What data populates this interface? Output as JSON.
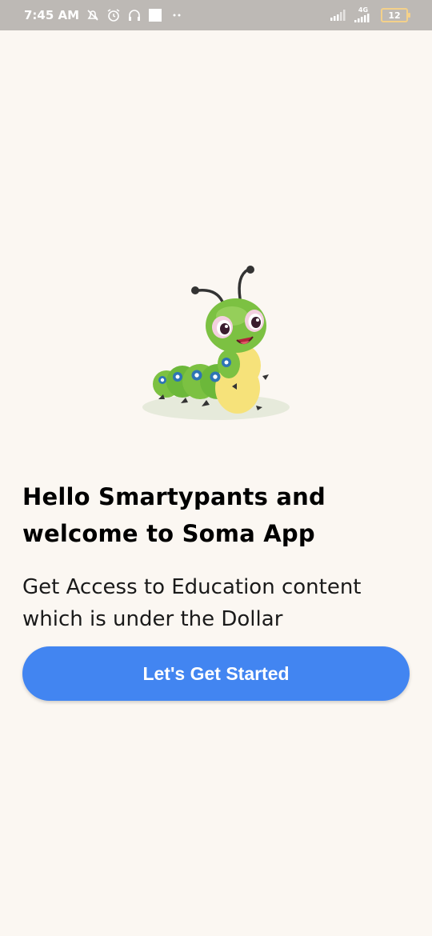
{
  "status_bar": {
    "time": "7:45 AM",
    "icons": [
      "alarm-off-icon",
      "alarm-clock-icon",
      "headset-icon",
      "square-notification-icon",
      "more-dots-icon"
    ],
    "network_label": "4G",
    "battery_level": "12",
    "colors": {
      "background": "#bdb9b5",
      "battery_outline": "#f4d18a"
    }
  },
  "hero": {
    "image": "caterpillar-illustration"
  },
  "welcome": {
    "headline_line1": "Hello Smartypants and",
    "headline_line2": "welcome to Soma App",
    "subtitle_line1": "Get Access to Education content",
    "subtitle_line2": "which is under the Dollar"
  },
  "cta": {
    "label": "Let's Get Started",
    "color": "#4285f1"
  },
  "theme": {
    "background": "#fbf7f2"
  }
}
